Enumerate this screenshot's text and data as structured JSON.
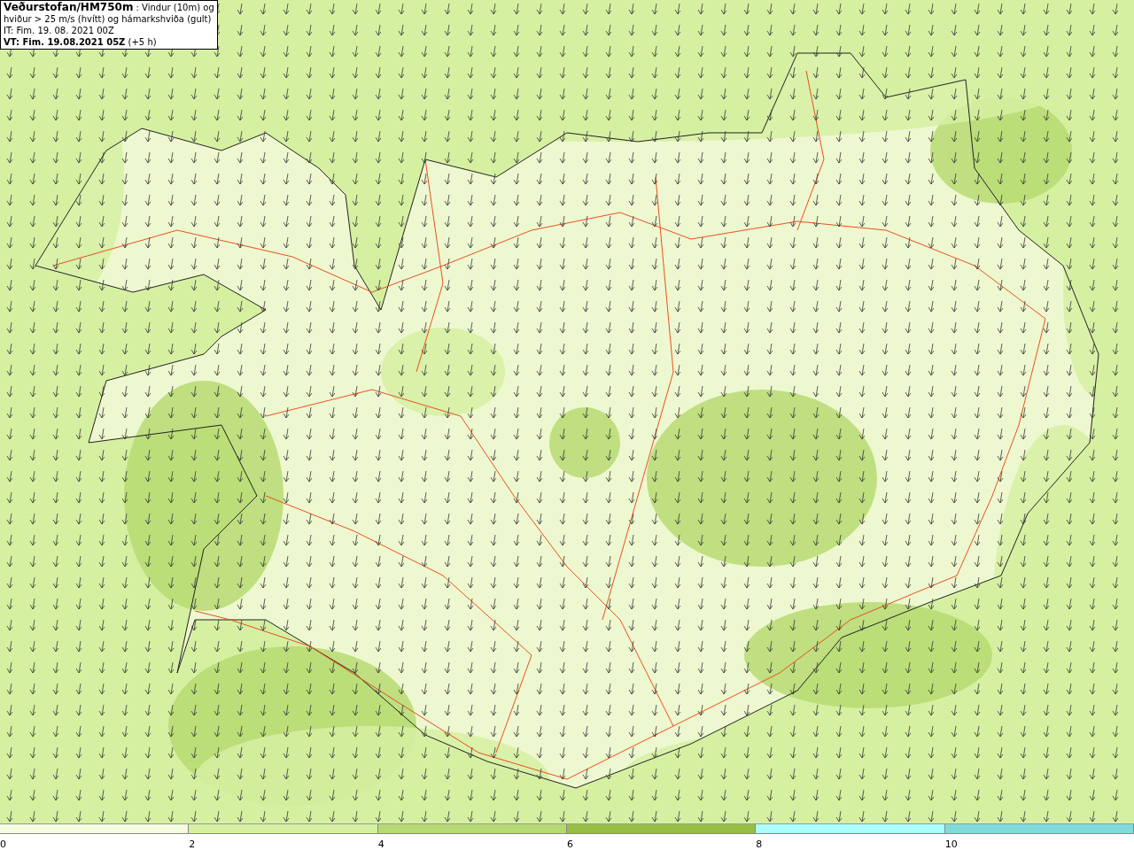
{
  "header": {
    "lines": [
      "**Veðurstofan/HM750m** : Vindur (10m) og",
      "hviður > 25 m/s (hvítt) og hámarkshviða (gult)",
      "IT: Fim. 19. 08. 2021 00Z",
      "**VT: Fim. 19.08.2021 05Z** (+5 h)"
    ]
  },
  "legend": {
    "bins": [
      {
        "label": "0",
        "color": "#f5fbde"
      },
      {
        "label": "2",
        "color": "#d6f0a2"
      },
      {
        "label": "4",
        "color": "#b6da72"
      },
      {
        "label": "6",
        "color": "#96bf44"
      },
      {
        "label": "8",
        "color": "#aaffff"
      },
      {
        "label": "10",
        "color": "#80dcdc"
      }
    ]
  }
}
